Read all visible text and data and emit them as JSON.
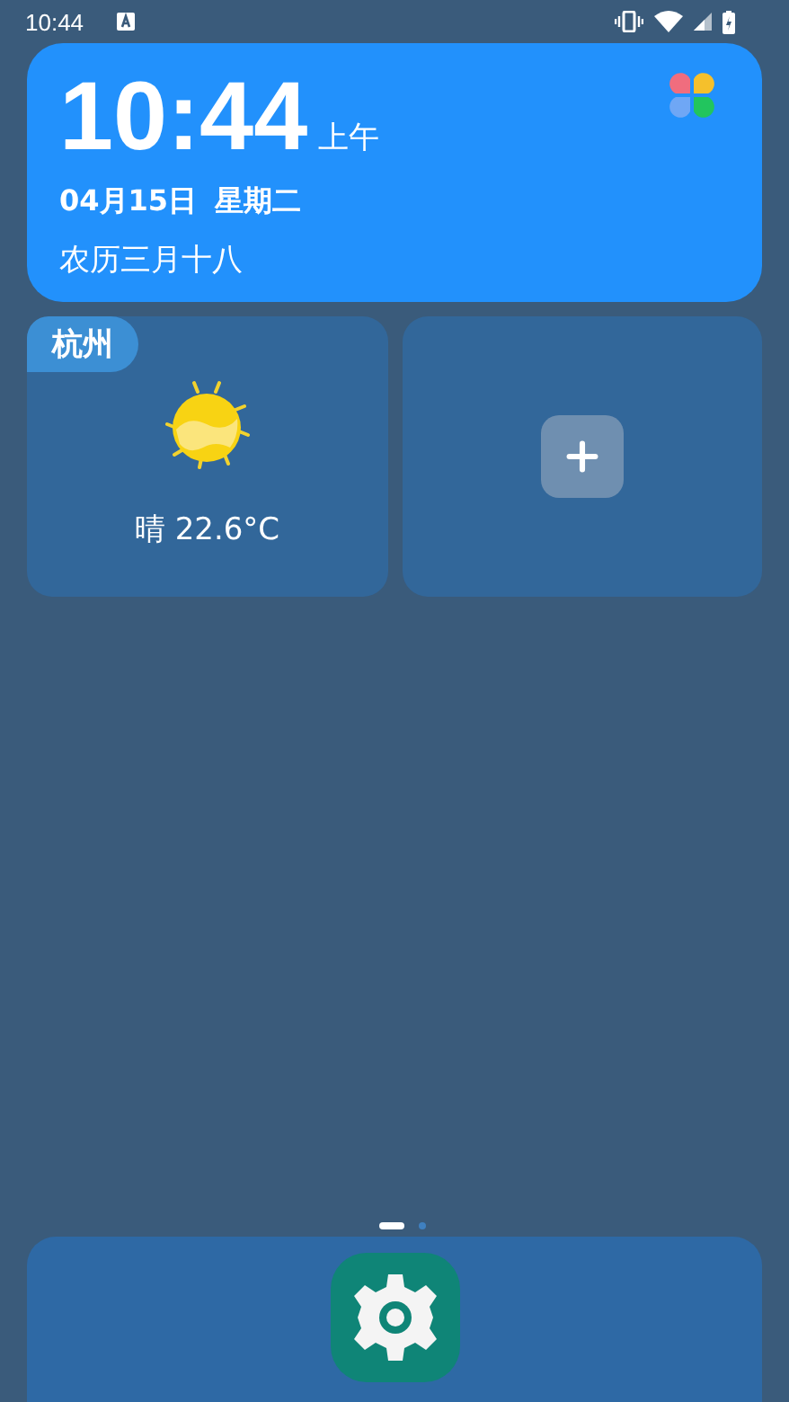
{
  "status_bar": {
    "time": "10:44"
  },
  "clock": {
    "time": "10:44",
    "period": "上午",
    "date": "04月15日",
    "weekday": "星期二",
    "lunar": "农历三月十八"
  },
  "weather": {
    "city": "杭州",
    "reading": "晴 22.6°C"
  },
  "page_dots": [
    {
      "selected": true
    },
    {
      "selected": false
    }
  ],
  "dock": {
    "apps": [
      {
        "kind": "settings"
      }
    ]
  }
}
